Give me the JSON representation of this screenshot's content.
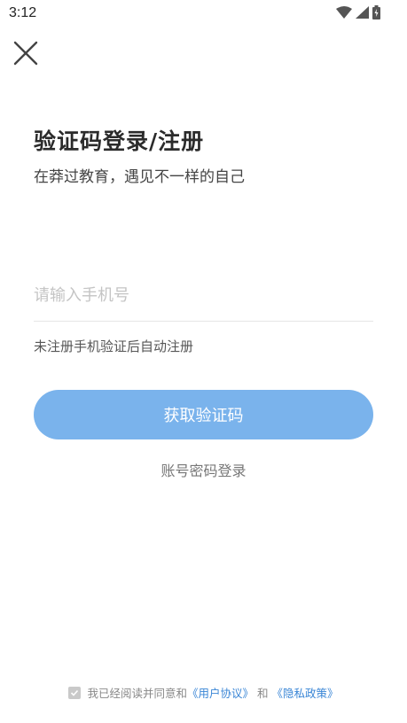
{
  "status_bar": {
    "time": "3:12",
    "icons": [
      "wifi-icon",
      "signal-icon",
      "battery-icon"
    ]
  },
  "header": {
    "close_icon": "close-icon"
  },
  "main": {
    "title": "验证码登录/注册",
    "subtitle": "在莽过教育，遇见不一样的自己",
    "phone_placeholder": "请输入手机号",
    "phone_value": "",
    "hint": "未注册手机验证后自动注册",
    "get_code_label": "获取验证码",
    "password_login_label": "账号密码登录"
  },
  "footer": {
    "agreement_prefix": "我已经阅读并同意和",
    "user_agreement": "《用户协议》",
    "and": "和",
    "privacy_policy": "《隐私政策》",
    "checked": true
  },
  "colors": {
    "accent": "#7ab3ec",
    "link": "#3a86d6"
  }
}
